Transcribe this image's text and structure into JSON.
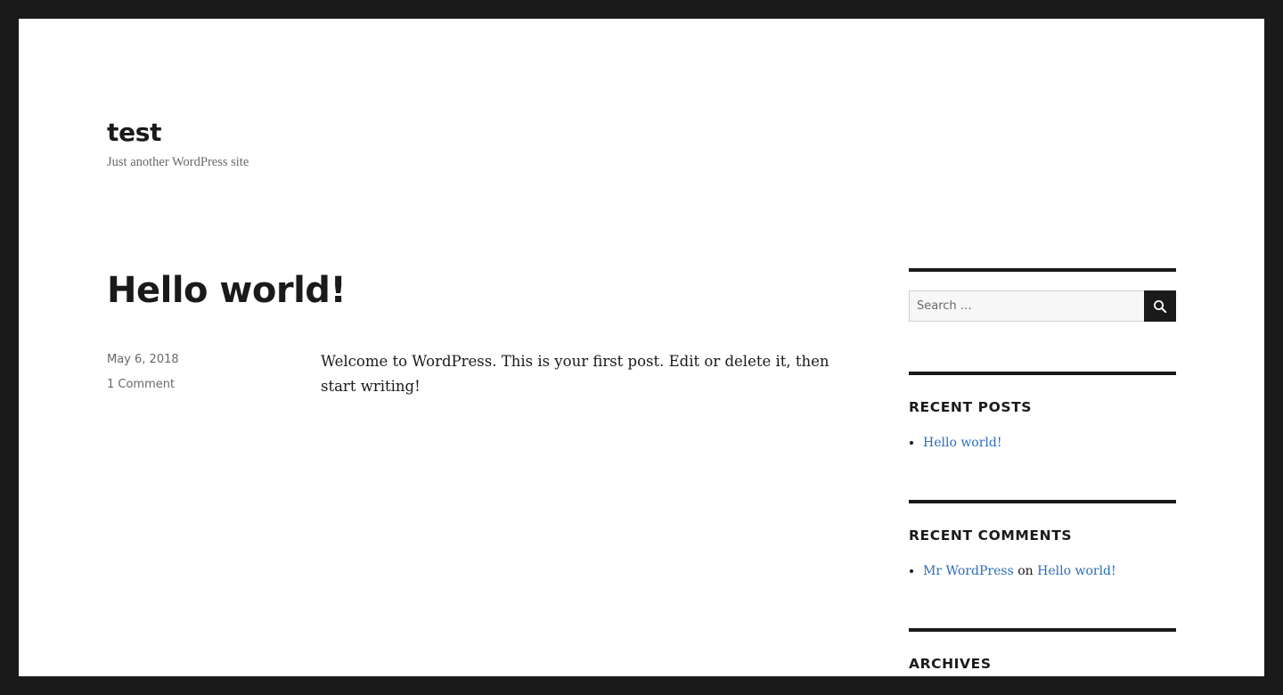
{
  "site": {
    "title": "test",
    "description": "Just another WordPress site"
  },
  "post": {
    "title": "Hello world!",
    "date": "May 6, 2018",
    "comments": "1 Comment",
    "content": "Welcome to WordPress. This is your first post. Edit or delete it, then start writing!"
  },
  "sidebar": {
    "search": {
      "placeholder": "Search …",
      "value": "",
      "icon": "search-icon"
    },
    "recent_posts": {
      "title": "RECENT POSTS",
      "items": [
        {
          "label": "Hello world!"
        }
      ]
    },
    "recent_comments": {
      "title": "RECENT COMMENTS",
      "items": [
        {
          "author": "Mr WordPress",
          "connector": "on",
          "post": "Hello world!"
        }
      ]
    },
    "archives": {
      "title": "ARCHIVES"
    }
  },
  "colors": {
    "frame": "#1a1a1a",
    "background": "#ffffff",
    "text": "#1a1a1a",
    "muted": "#686868",
    "link": "#2b6cb8"
  }
}
